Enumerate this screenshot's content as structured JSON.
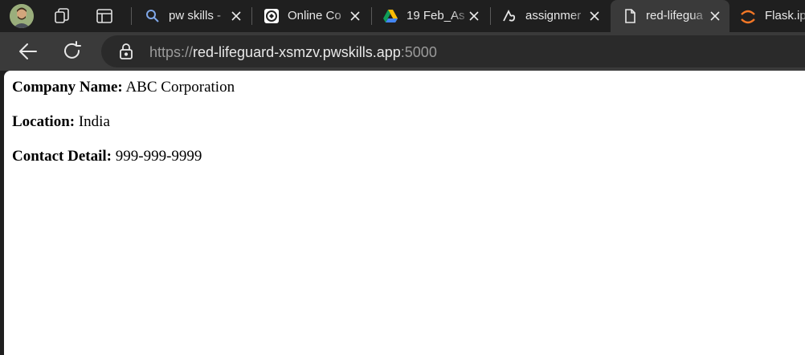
{
  "browser": {
    "tabs": [
      {
        "title": "pw skills -",
        "icon": "search-icon"
      },
      {
        "title": "Online Co",
        "icon": "online-compiler-favicon"
      },
      {
        "title": "19 Feb_As",
        "icon": "google-drive-icon"
      },
      {
        "title": "assignmer",
        "icon": "assignment-favicon"
      },
      {
        "title": "red-lifegua",
        "icon": "page-icon"
      },
      {
        "title": "Flask.ip",
        "icon": "jupyter-icon"
      }
    ],
    "active_tab_index": 4,
    "url": {
      "scheme": "https://",
      "host": "red-lifeguard-xsmzv.pwskills.app",
      "port": ":5000"
    }
  },
  "page": {
    "company_label": "Company Name:",
    "company_value": "ABC Corporation",
    "location_label": "Location:",
    "location_value": "India",
    "contact_label": "Contact Detail:",
    "contact_value": "999-999-9999"
  },
  "colors": {
    "tabbar_bg": "#1f1f1f",
    "toolbar_bg": "#3a3a3a",
    "page_bg": "#ffffff"
  }
}
